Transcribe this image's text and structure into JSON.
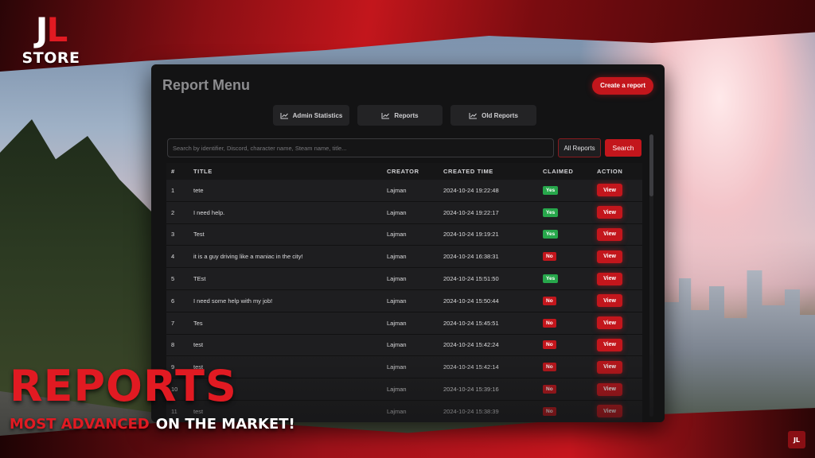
{
  "logo": {
    "mark_j": "J",
    "mark_l": "L",
    "store": "STORE"
  },
  "panel": {
    "title": "Report Menu",
    "create_button": "Create a report",
    "tabs": [
      {
        "label": "Admin Statistics",
        "icon": "chart-line-icon"
      },
      {
        "label": "Reports",
        "icon": "chart-line-icon"
      },
      {
        "label": "Old Reports",
        "icon": "chart-line-icon"
      }
    ],
    "search": {
      "placeholder": "Search by identifier, Discord, character name, Steam name, title...",
      "value": "",
      "filter_label": "All Reports",
      "button_label": "Search"
    },
    "table": {
      "headers": {
        "num": "#",
        "title": "TITLE",
        "creator": "CREATOR",
        "created": "CREATED TIME",
        "claimed": "CLAIMED",
        "action": "ACTION"
      },
      "view_label": "View",
      "rows": [
        {
          "num": "1",
          "title": "tete",
          "creator": "Lajman",
          "created": "2024-10-24 19:22:48",
          "claimed": "Yes"
        },
        {
          "num": "2",
          "title": "I need help.",
          "creator": "Lajman",
          "created": "2024-10-24 19:22:17",
          "claimed": "Yes"
        },
        {
          "num": "3",
          "title": "Test",
          "creator": "Lajman",
          "created": "2024-10-24 19:19:21",
          "claimed": "Yes"
        },
        {
          "num": "4",
          "title": "it is a guy driving like a maniac in the city!",
          "creator": "Lajman",
          "created": "2024-10-24 16:38:31",
          "claimed": "No"
        },
        {
          "num": "5",
          "title": "TEst",
          "creator": "Lajman",
          "created": "2024-10-24 15:51:50",
          "claimed": "Yes"
        },
        {
          "num": "6",
          "title": "I need some help with my job!",
          "creator": "Lajman",
          "created": "2024-10-24 15:50:44",
          "claimed": "No"
        },
        {
          "num": "7",
          "title": "Tes",
          "creator": "Lajman",
          "created": "2024-10-24 15:45:51",
          "claimed": "No"
        },
        {
          "num": "8",
          "title": "test",
          "creator": "Lajman",
          "created": "2024-10-24 15:42:24",
          "claimed": "No"
        },
        {
          "num": "9",
          "title": "test",
          "creator": "Lajman",
          "created": "2024-10-24 15:42:14",
          "claimed": "No"
        },
        {
          "num": "10",
          "title": "",
          "creator": "Lajman",
          "created": "2024-10-24 15:39:16",
          "claimed": "No"
        },
        {
          "num": "11",
          "title": "test",
          "creator": "Lajman",
          "created": "2024-10-24 15:38:39",
          "claimed": "No"
        }
      ]
    }
  },
  "promo": {
    "title": "REPORTS",
    "sub_accent": "MOST ADVANCED",
    "sub_plain": "ON THE MARKET!"
  },
  "corner_logo": "JL",
  "colors": {
    "accent": "#c3161c",
    "yes": "#27a74b",
    "panel": "#131314"
  }
}
